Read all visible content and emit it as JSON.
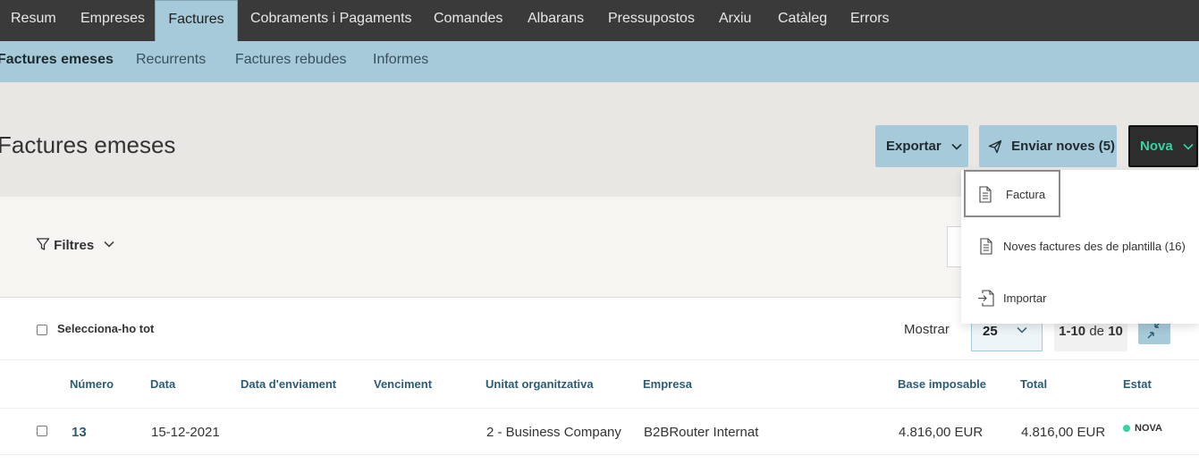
{
  "top_nav": {
    "tabs": [
      "Resum",
      "Empreses",
      "Factures",
      "Cobraments i Pagaments",
      "Comandes",
      "Albarans",
      "Pressupostos",
      "Arxiu",
      "Catàleg",
      "Errors"
    ],
    "active": "Factures"
  },
  "sub_nav": {
    "tabs": [
      "Factures emeses",
      "Recurrents",
      "Factures rebudes",
      "Informes"
    ],
    "active": "Factures emeses"
  },
  "header": {
    "title": "Factures emeses",
    "export_label": "Exportar",
    "send_label": "Enviar noves (5)",
    "new_label": "Nova"
  },
  "new_menu": {
    "items": [
      "Factura",
      "Noves factures des de plantilla (16)",
      "Importar"
    ]
  },
  "filters": {
    "label": "Filtres"
  },
  "toolbar": {
    "select_all_label": "Selecciona-ho tot",
    "show_label": "Mostrar",
    "per_page": "25",
    "range": "1-10",
    "range_of": "de",
    "total": "10"
  },
  "table": {
    "columns": [
      "Número",
      "Data",
      "Data d'enviament",
      "Venciment",
      "Unitat organitzativa",
      "Empresa",
      "Base imposable",
      "Total",
      "Estat"
    ],
    "rows": [
      {
        "number": "13",
        "date": "15-12-2021",
        "sent_date": "",
        "due_date": "",
        "org_unit": "2 - Business Company",
        "company": "B2BRouter Internat",
        "taxable_base": "4.816,00 EUR",
        "total": "4.816,00 EUR",
        "status": "NOVA"
      }
    ]
  },
  "colors": {
    "topnav_bg": "#3a3a3a",
    "accent_blue": "#a6cad9",
    "accent_green": "#35d4a2",
    "link_blue": "#2c5d74"
  }
}
